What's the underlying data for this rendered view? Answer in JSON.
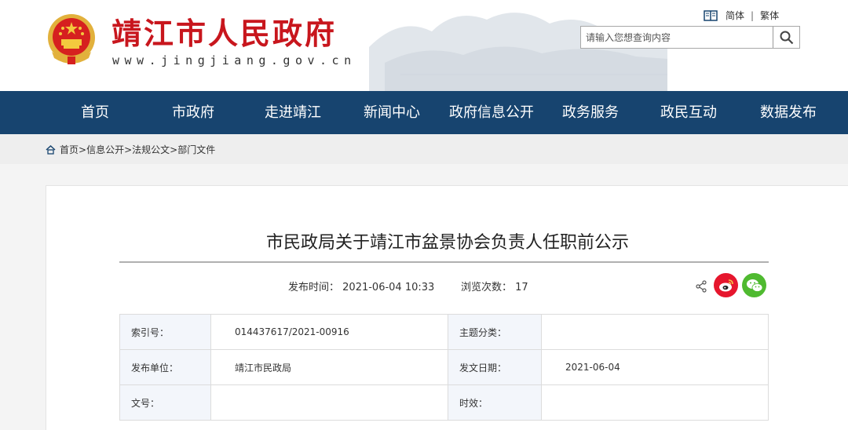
{
  "header": {
    "title": "靖江市人民政府",
    "url": "www.jingjiang.gov.cn",
    "lang_simplified": "简体",
    "lang_separator": "|",
    "lang_traditional": "繁体",
    "search_placeholder": "请输入您想查询内容"
  },
  "nav": {
    "items": [
      "首页",
      "市政府",
      "走进靖江",
      "新闻中心",
      "政府信息公开",
      "政务服务",
      "政民互动",
      "数据发布"
    ]
  },
  "breadcrumb": {
    "items": [
      "首页",
      "信息公开",
      "法规公文",
      "部门文件"
    ],
    "separator": ">"
  },
  "article": {
    "title": "市民政局关于靖江市盆景协会负责人任职前公示",
    "publish_label": "发布时间：",
    "publish_time": "2021-06-04 10:33",
    "views_label": "浏览次数：",
    "views": "17"
  },
  "info_table": {
    "rows": [
      {
        "label1": "索引号：",
        "value1": "014437617/2021-00916",
        "label2": "主题分类：",
        "value2": ""
      },
      {
        "label1": "发布单位：",
        "value1": "靖江市民政局",
        "label2": "发文日期：",
        "value2": "2021-06-04"
      },
      {
        "label1": "文号：",
        "value1": "",
        "label2": "时效：",
        "value2": ""
      }
    ]
  },
  "icons": {
    "emblem": "national-emblem-icon",
    "language": "book-icon",
    "search": "search-icon",
    "home": "home-icon",
    "share": "share-icon",
    "weibo": "weibo-icon",
    "wechat": "wechat-icon"
  },
  "colors": {
    "brand_red": "#c8161d",
    "nav_blue": "#17446f",
    "weibo_red": "#e6162d",
    "wechat_green": "#4fba30"
  }
}
